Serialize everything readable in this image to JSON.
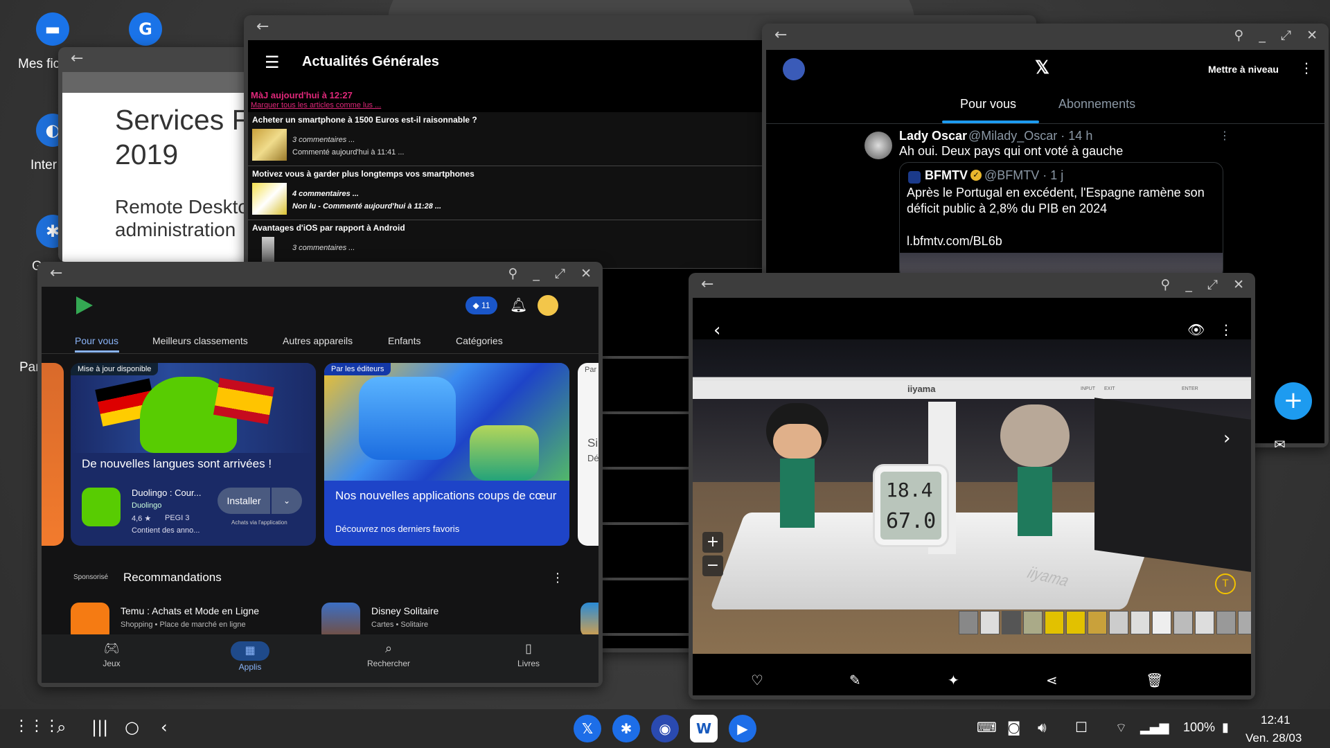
{
  "desktop": {
    "icons": [
      {
        "label": "Mes fic"
      },
      {
        "label": "Inter"
      },
      {
        "label": "G"
      },
      {
        "label": "Par"
      }
    ]
  },
  "doc_window": {
    "heading_line1": "Services F",
    "heading_line2": "2019",
    "sub_line1": "Remote Deskto",
    "sub_line2": "administration"
  },
  "news": {
    "title": "Actualités Générales",
    "updated": "MàJ aujourd'hui à 12:27",
    "mark_all": "Marquer tous les articles comme lus ...",
    "items": [
      {
        "title": "Acheter un smartphone à 1500 Euros est-il raisonnable ?",
        "meta1": "3 commentaires ...",
        "meta2": "Commenté aujourd'hui à 11:41 ..."
      },
      {
        "title": "Motivez vous à garder plus longtemps vos smartphones",
        "meta1": "4 commentaires ...",
        "meta2": "Non lu - Commenté aujourd'hui à 11:28 ..."
      },
      {
        "title": "Avantages d'iOS par rapport à Android",
        "meta1": "3 commentaires ...",
        "meta2": ""
      }
    ]
  },
  "twitter": {
    "upgrade": "Mettre à niveau",
    "tabs": [
      "Pour vous",
      "Abonnements"
    ],
    "tweet": {
      "author": "Lady Oscar",
      "handle": "@Milady_Oscar · 14 h",
      "text": "Ah oui. Deux pays qui ont voté à gauche"
    },
    "quote": {
      "author": "BFMTV",
      "handle": "@BFMTV · 1 j",
      "text": "Après le Portugal en excédent, l'Espagne ramène son déficit public à 2,8% du PIB en 2024",
      "link": "l.bfmtv.com/BL6b"
    },
    "fab": "+"
  },
  "play": {
    "points": "11",
    "tabs": [
      "Pour vous",
      "Meilleurs classements",
      "Autres appareils",
      "Enfants",
      "Catégories"
    ],
    "card1": {
      "badge": "Mise à jour disponible",
      "headline": "De nouvelles langues sont arrivées !",
      "app_name": "Duolingo : Cour...",
      "developer": "Duolingo",
      "rating": "4,6 ★",
      "pegi": "PEGI 3",
      "ads": "Contient des anno...",
      "install": "Installer",
      "iap": "Achats via l'application"
    },
    "card2": {
      "badge": "Par les éditeurs",
      "headline": "Nos nouvelles applications coups de cœur",
      "sub": "Découvrez nos derniers favoris"
    },
    "card3": {
      "badge": "Par",
      "t1": "Si",
      "t2": "Dé"
    },
    "sponsored": "Sponsorisé",
    "section": "Recommandations",
    "recs": [
      {
        "name": "Temu : Achats et Mode en Ligne",
        "cat": "Shopping • Place de marché en ligne"
      },
      {
        "name": "Disney Solitaire",
        "cat": "Cartes • Solitaire"
      }
    ],
    "nav": [
      "Jeux",
      "Applis",
      "Rechercher",
      "Livres"
    ]
  },
  "photo": {
    "monitor_brand": "iiyama",
    "monitor_labels": [
      "INPUT",
      "EXIT",
      "ENTER"
    ],
    "thermo_temp": "18.4",
    "thermo_hum": "67.0",
    "stand_brand": "iiyama",
    "zoom_in": "+",
    "zoom_out": "−"
  },
  "taskbar": {
    "battery": "100%",
    "time": "12:41",
    "date": "Ven. 28/03"
  }
}
